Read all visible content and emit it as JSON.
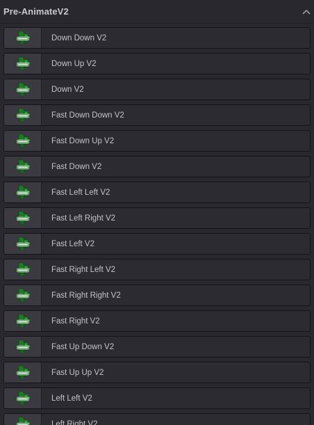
{
  "panel": {
    "title": "Pre-AnimateV2",
    "collapse_icon": "chevron-up-icon",
    "thumbnail_icon": "animate-logo-icon",
    "items": [
      {
        "label": "Down Down V2"
      },
      {
        "label": "Down Up V2"
      },
      {
        "label": "Down V2"
      },
      {
        "label": "Fast Down Down V2"
      },
      {
        "label": "Fast Down Up V2"
      },
      {
        "label": "Fast Down V2"
      },
      {
        "label": "Fast Left Left V2"
      },
      {
        "label": "Fast Left Right V2"
      },
      {
        "label": "Fast Left V2"
      },
      {
        "label": "Fast Right Left V2"
      },
      {
        "label": "Fast Right Right V2"
      },
      {
        "label": "Fast Right V2"
      },
      {
        "label": "Fast Up Down V2"
      },
      {
        "label": "Fast Up Up V2"
      },
      {
        "label": "Left Left V2"
      },
      {
        "label": "Left Right V2"
      }
    ]
  },
  "colors": {
    "background": "#28282e",
    "item_background": "#2b2b31",
    "thumb_background": "#3a3a40",
    "logo_green": "#1f8a2a",
    "text": "#c4c4c8"
  }
}
